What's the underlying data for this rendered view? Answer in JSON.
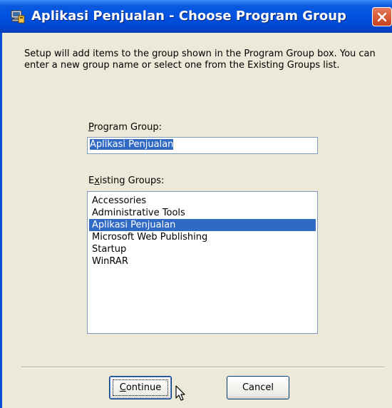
{
  "window": {
    "title": "Aplikasi Penjualan - Choose Program Group"
  },
  "description": "Setup will add items to the group shown in the Program Group box. You can enter a new group name or select one from the Existing Groups list.",
  "program_group": {
    "label": "Program Group:",
    "value": "Aplikasi Penjualan"
  },
  "existing_groups": {
    "label": "Existing Groups:",
    "items": [
      {
        "label": "Accessories",
        "selected": false
      },
      {
        "label": "Administrative Tools",
        "selected": false
      },
      {
        "label": "Aplikasi Penjualan",
        "selected": true
      },
      {
        "label": "Microsoft Web Publishing",
        "selected": false
      },
      {
        "label": "Startup",
        "selected": false
      },
      {
        "label": "WinRAR",
        "selected": false
      }
    ]
  },
  "buttons": {
    "continue_label": "Continue",
    "cancel_label": "Cancel"
  },
  "icons": {
    "title": "setup-computer-icon",
    "close": "close-icon",
    "cursor": "mouse-pointer-icon"
  },
  "colors": {
    "title_bar": "#0053e1",
    "selection": "#316ac5",
    "dialog_face": "#ece9d8",
    "close_button": "#d9542b"
  }
}
